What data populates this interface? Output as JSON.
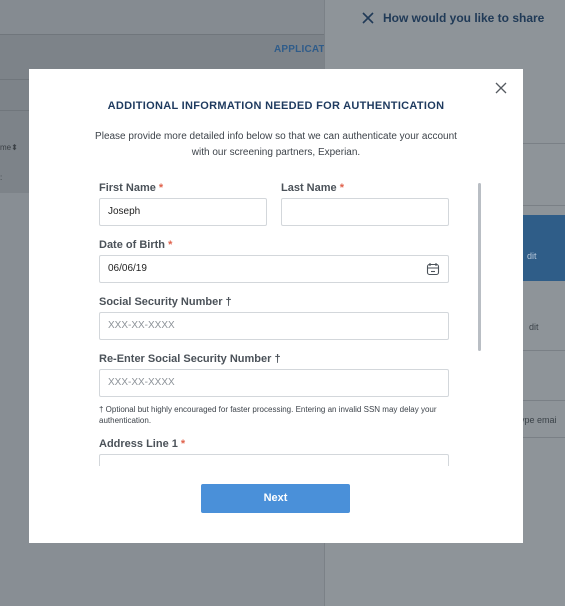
{
  "background": {
    "left_tab_label": "APPLICAT",
    "left_fragment_1": "me⬍",
    "left_fragment_2": ":",
    "right_title": "How would you like to share",
    "right_edit_1": "dit",
    "right_edit_2": "dit",
    "right_email_placeholder": "ype emai"
  },
  "modal": {
    "title": "ADDITIONAL INFORMATION NEEDED FOR AUTHENTICATION",
    "intro": "Please provide more detailed info below so that we can authenticate your account with our screening partners, Experian.",
    "fields": {
      "first_name": {
        "label": "First Name",
        "required_mark": "*",
        "value": "Joseph"
      },
      "last_name": {
        "label": "Last Name",
        "required_mark": "*",
        "value": ""
      },
      "dob": {
        "label": "Date of Birth",
        "required_mark": "*",
        "value": "06/06/19"
      },
      "ssn": {
        "label": "Social Security Number †",
        "placeholder": "XXX-XX-XXXX"
      },
      "ssn_confirm": {
        "label": "Re-Enter Social Security Number †",
        "placeholder": "XXX-XX-XXXX"
      },
      "ssn_note": "† Optional but highly encouraged for faster processing. Entering an invalid SSN may delay your authentication.",
      "address1": {
        "label": "Address Line 1",
        "required_mark": "*",
        "value": ""
      }
    },
    "next_label": "Next"
  },
  "colors": {
    "accent": "#4a90d9",
    "title": "#1e3a5f",
    "required": "#e0624c"
  },
  "icons": [
    "close-icon",
    "calendar-icon"
  ]
}
